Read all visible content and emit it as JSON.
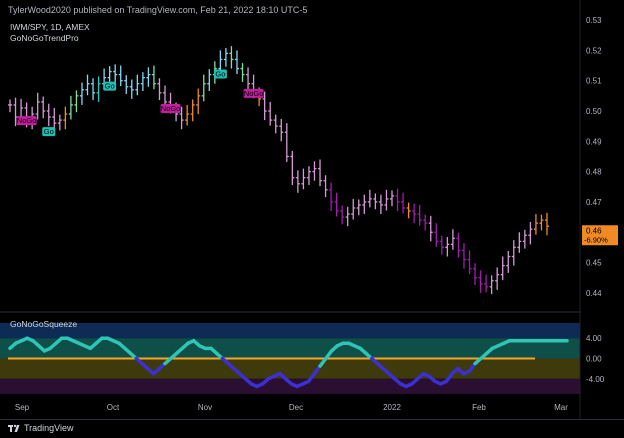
{
  "header": {
    "published": "TylerWood2020 published on TradingView.com, Feb 21, 2022 18:10 UTC-5"
  },
  "symbol": {
    "label": "IWM/SPY, 1D, AMEX"
  },
  "indicator": {
    "name": "GoNoGoTrendPro"
  },
  "squeeze": {
    "name": "GoNoGoSqueeze"
  },
  "footer": {
    "brand": "TradingView"
  },
  "colors": {
    "background": "#000000",
    "go_strong": "#22c7c2",
    "go_weak": "#86d7f2",
    "go_up": "#7fe0a0",
    "nogo_strong": "#a21caf",
    "nogo_weak": "#d59ad6",
    "amber": "#f08a24",
    "go_badge": "#1fbfb5",
    "nogo_badge": "#c21f9e",
    "price_tag": "#f08a24",
    "zero_line": "#f5a623",
    "osc_positive": "#2ec4b6",
    "osc_negative": "#3b2fd6"
  },
  "chart_data": [
    {
      "type": "ohlc-bars",
      "symbol": "IWM/SPY",
      "interval": "1D",
      "exchange": "AMEX",
      "y_axis": {
        "ticks": [
          0.44,
          0.45,
          0.46,
          0.47,
          0.48,
          0.49,
          0.5,
          0.51,
          0.52,
          0.53
        ],
        "range": [
          0.436,
          0.532
        ]
      },
      "x_axis": {
        "ticks": [
          "Sep",
          "Oct",
          "Nov",
          "Dec",
          "2022",
          "Feb",
          "Mar"
        ]
      },
      "last_price": "0.46",
      "change": "-6.90%",
      "closes": [
        0.502,
        0.498,
        0.501,
        0.497,
        0.499,
        0.503,
        0.5,
        0.498,
        0.496,
        0.497,
        0.499,
        0.502,
        0.505,
        0.507,
        0.509,
        0.506,
        0.509,
        0.511,
        0.513,
        0.512,
        0.51,
        0.508,
        0.507,
        0.509,
        0.511,
        0.512,
        0.509,
        0.506,
        0.503,
        0.501,
        0.499,
        0.497,
        0.499,
        0.502,
        0.505,
        0.509,
        0.512,
        0.514,
        0.517,
        0.519,
        0.517,
        0.514,
        0.512,
        0.509,
        0.506,
        0.504,
        0.5,
        0.497,
        0.495,
        0.493,
        0.485,
        0.478,
        0.476,
        0.478,
        0.48,
        0.481,
        0.477,
        0.474,
        0.47,
        0.467,
        0.465,
        0.466,
        0.468,
        0.469,
        0.47,
        0.471,
        0.47,
        0.469,
        0.471,
        0.472,
        0.47,
        0.468,
        0.467,
        0.466,
        0.464,
        0.463,
        0.46,
        0.457,
        0.455,
        0.456,
        0.458,
        0.454,
        0.451,
        0.448,
        0.445,
        0.443,
        0.442,
        0.444,
        0.446,
        0.449,
        0.452,
        0.455,
        0.457,
        0.459,
        0.461,
        0.463,
        0.464,
        0.462
      ],
      "bar_classes": [
        "nogo_weak",
        "nogo_weak",
        "nogo_weak",
        "nogo_weak",
        "nogo_weak",
        "nogo_weak",
        "nogo_weak",
        "nogo_weak",
        "nogo_weak",
        "nogo_weak",
        "amber",
        "go_up",
        "go_up",
        "go_weak",
        "go_weak",
        "go_weak",
        "go_strong",
        "go_weak",
        "go_weak",
        "go_weak",
        "go_weak",
        "go_weak",
        "go_weak",
        "go_weak",
        "go_weak",
        "go_weak",
        "go_up",
        "nogo_weak",
        "nogo_weak",
        "nogo_weak",
        "nogo_weak",
        "nogo_weak",
        "amber",
        "amber",
        "amber",
        "go_up",
        "go_weak",
        "go_up",
        "go_weak",
        "go_weak",
        "go_up",
        "go_weak",
        "go_up",
        "nogo_weak",
        "nogo_weak",
        "amber",
        "nogo_weak",
        "nogo_weak",
        "nogo_weak",
        "nogo_weak",
        "nogo_weak",
        "nogo_weak",
        "nogo_weak",
        "nogo_weak",
        "nogo_weak",
        "nogo_weak",
        "nogo_weak",
        "nogo_weak",
        "nogo_strong",
        "nogo_strong",
        "nogo_strong",
        "nogo_weak",
        "nogo_weak",
        "nogo_weak",
        "nogo_weak",
        "nogo_weak",
        "nogo_weak",
        "nogo_weak",
        "nogo_weak",
        "nogo_weak",
        "nogo_strong",
        "nogo_strong",
        "amber",
        "nogo_strong",
        "nogo_strong",
        "nogo_strong",
        "nogo_weak",
        "nogo_strong",
        "nogo_strong",
        "nogo_weak",
        "nogo_weak",
        "nogo_strong",
        "nogo_strong",
        "nogo_strong",
        "nogo_strong",
        "nogo_strong",
        "nogo_strong",
        "nogo_weak",
        "nogo_weak",
        "nogo_weak",
        "nogo_weak",
        "nogo_weak",
        "nogo_weak",
        "nogo_weak",
        "nogo_weak",
        "amber",
        "amber",
        "amber"
      ],
      "signals": [
        {
          "label": "NoGo",
          "type": "nogo",
          "bar": 3
        },
        {
          "label": "Go",
          "type": "go",
          "bar": 7
        },
        {
          "label": "Go",
          "type": "go",
          "bar": 18
        },
        {
          "label": "NoGo",
          "type": "nogo",
          "bar": 29
        },
        {
          "label": "Go",
          "type": "go",
          "bar": 38
        },
        {
          "label": "NoGo",
          "type": "nogo",
          "bar": 44
        }
      ]
    },
    {
      "type": "oscillator",
      "name": "GoNoGoSqueeze",
      "y_axis": {
        "ticks": [
          "4.00",
          "0.00",
          "-4.00"
        ],
        "range": [
          -7,
          7
        ]
      },
      "values": [
        2,
        3,
        3.5,
        4,
        3.5,
        2.5,
        1.5,
        2,
        3,
        4,
        4,
        3.5,
        3,
        2.5,
        2,
        3,
        4,
        4,
        3.5,
        3,
        2,
        1,
        0,
        -1,
        -2,
        -3,
        -2,
        -1,
        0,
        1,
        2,
        3,
        3.5,
        2.5,
        2,
        2,
        1,
        0,
        -1,
        -2,
        -3,
        -4,
        -5,
        -5.5,
        -5,
        -4,
        -3.5,
        -3,
        -4,
        -5,
        -5.5,
        -5,
        -4.5,
        -3,
        -1.5,
        0,
        1.5,
        2.5,
        3,
        3,
        2.5,
        2,
        1,
        0,
        -1,
        -2,
        -3,
        -4,
        -5,
        -5.5,
        -5,
        -4,
        -3,
        -3.5,
        -4.5,
        -5,
        -4.5,
        -3,
        -2,
        -3,
        -2.5,
        -1,
        0,
        1,
        2,
        2.5,
        3,
        3.5,
        3.5,
        3.5,
        3.5,
        3.5,
        3.5,
        3.5,
        3.5,
        3.5,
        3.5,
        3.5
      ],
      "squeeze_zero_line": 0
    }
  ]
}
